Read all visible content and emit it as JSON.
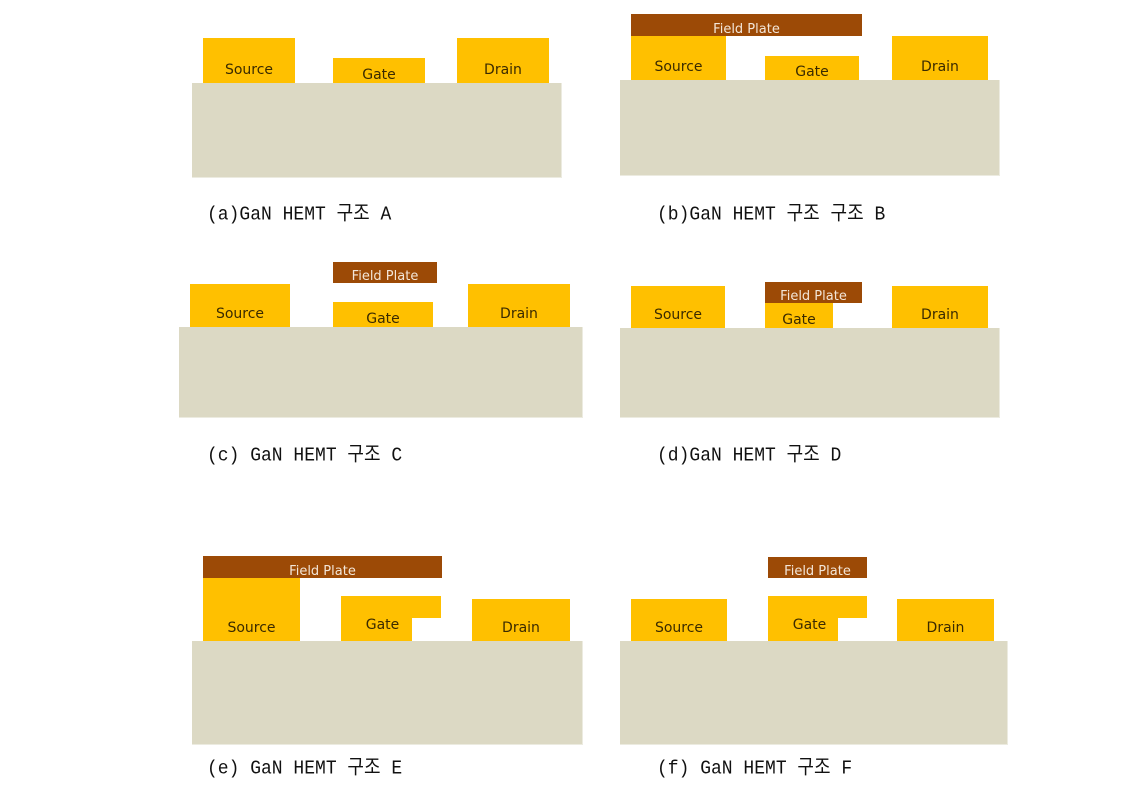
{
  "labels": {
    "source": "Source",
    "gate": "Gate",
    "drain": "Drain",
    "field_plate": "Field Plate"
  },
  "colors": {
    "substrate": "#dcd9c4",
    "metal": "#ffc000",
    "field_plate": "#9c4a06"
  },
  "panels": [
    {
      "caption": "(a)GaN HEMT 구조 A"
    },
    {
      "caption": "(b)GaN HEMT 구조 구조 B"
    },
    {
      "caption": "(c) GaN HEMT 구조 C"
    },
    {
      "caption": "(d)GaN HEMT 구조 D"
    },
    {
      "caption": "(e) GaN HEMT 구조 E"
    },
    {
      "caption": "(f) GaN HEMT 구조 F"
    }
  ]
}
